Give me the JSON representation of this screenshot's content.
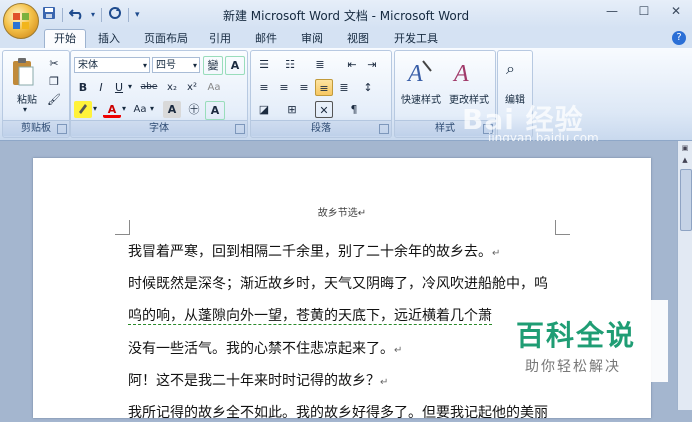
{
  "window": {
    "title": "新建 Microsoft Word 文档 - Microsoft Word",
    "controls": [
      "minimize-icon",
      "maximize-icon",
      "close-icon"
    ]
  },
  "quick_access": {
    "items": [
      "save-icon",
      "undo-icon",
      "redo-icon",
      "customize-icon"
    ]
  },
  "tabs": [
    "开始",
    "插入",
    "页面布局",
    "引用",
    "邮件",
    "审阅",
    "视图",
    "开发工具"
  ],
  "active_tab": "开始",
  "ribbon": {
    "clipboard": {
      "paste_label": "粘贴",
      "group_label": "剪贴板"
    },
    "font": {
      "font_name": "宋体",
      "font_size": "四号",
      "size_up": "A",
      "wen_button": "變",
      "group_label": "字体",
      "buttons": [
        "B",
        "I",
        "U",
        "abe",
        "x₂",
        "x²",
        "Aa",
        "A",
        "A"
      ]
    },
    "paragraph": {
      "group_label": "段落"
    },
    "styles": {
      "quick_styles_label": "快速样式",
      "change_styles_label": "更改样式",
      "group_label": "样式"
    },
    "editing": {
      "label": "编辑"
    }
  },
  "document": {
    "header": "故乡节选↵",
    "lines": [
      "我冒着严寒，回到相隔二千余里，别了二十余年的故乡去。",
      "时候既然是深冬；渐近故乡时，天气又阴晦了，冷风吹进船舱中，呜",
      "呜的响，从蓬隙向外一望，苍黄的天底下，远近横着几个萧",
      "没有一些活气。我的心禁不住悲凉起来了。",
      "阿！这不是我二十年来时时记得的故乡？",
      "我所记得的故乡全不如此。我的故乡好得多了。但要我记起他的美丽"
    ],
    "para_mark": "↵"
  },
  "watermarks": {
    "baidu": "Bai 经验",
    "url": "jingyan.baidu.com",
    "baike_title": "百科全说",
    "baike_sub": "助你轻松解决"
  }
}
